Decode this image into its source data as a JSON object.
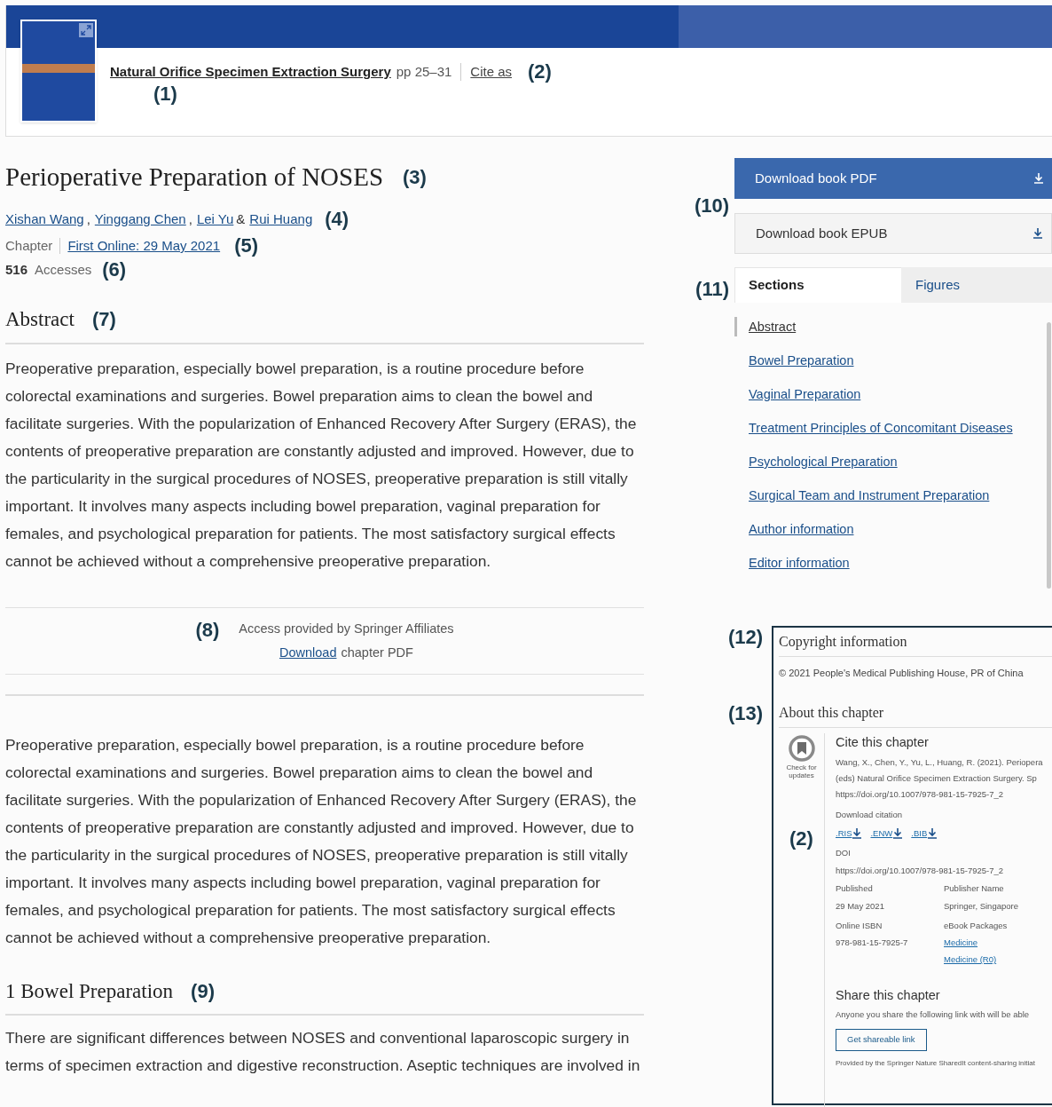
{
  "header": {
    "book_title": "Natural Orifice Specimen Extraction Surgery",
    "pages": "pp 25–31",
    "cite_link": "Cite as",
    "title_marker": "(1)",
    "cite_marker": "(2)"
  },
  "chapter": {
    "title": "Perioperative Preparation of NOSES",
    "title_marker": "(3)",
    "authors": [
      {
        "name": "Xishan Wang",
        "sep": ","
      },
      {
        "name": "Yinggang Chen",
        "sep": ","
      },
      {
        "name": "Lei Yu",
        "sep": "&"
      },
      {
        "name": "Rui Huang"
      }
    ],
    "authors_marker": "(4)",
    "type": "Chapter",
    "first_online": "First Online: 29 May 2021",
    "date_marker": "(5)",
    "accesses_count": "516",
    "accesses_label": "Accesses",
    "accesses_marker": "(6)"
  },
  "abstract": {
    "heading": "Abstract",
    "marker": "(7)",
    "text": "Preoperative preparation, especially bowel preparation, is a routine procedure before colorectal examinations and surgeries. Bowel preparation aims to clean the bowel and facilitate surgeries. With the popularization of Enhanced Recovery After Surgery (ERAS), the contents of preoperative preparation are constantly adjusted and improved. However, due to the particularity in the surgical procedures of NOSES, preoperative preparation is still vitally important. It involves many aspects including bowel preparation, vaginal preparation for females, and psychological preparation for patients. The most satisfactory surgical effects cannot be achieved without a comprehensive preoperative preparation."
  },
  "access_box": {
    "marker": "(8)",
    "provided": "Access provided by Springer Affiliates",
    "download_link": "Download",
    "download_rest": "chapter PDF"
  },
  "body": [
    {
      "kind": "paragraph",
      "text": "Preoperative preparation, especially bowel preparation, is a routine procedure before colorectal examinations and surgeries. Bowel preparation aims to clean the bowel and facilitate surgeries. With the popularization of Enhanced Recovery After Surgery (ERAS), the contents of preoperative preparation are constantly adjusted and improved. However, due to the particularity in the surgical procedures of NOSES, preoperative preparation is still vitally important. It involves many aspects including bowel preparation, vaginal preparation for females, and psychological preparation for patients. The most satisfactory surgical effects cannot be achieved without a comprehensive preoperative preparation."
    },
    {
      "kind": "heading",
      "text": "1 Bowel Preparation",
      "marker": "(9)"
    },
    {
      "kind": "paragraph",
      "text": "There are significant differences between NOSES and conventional laparoscopic surgery in terms of specimen extraction and digestive reconstruction. Aseptic techniques are involved in"
    }
  ],
  "downloads": {
    "marker": "(10)",
    "buttons": [
      {
        "label": "Download book PDF",
        "kind": "primary"
      },
      {
        "label": "Download book EPUB",
        "kind": "secondary"
      }
    ]
  },
  "navigation": {
    "marker": "(11)",
    "tabs": [
      {
        "label": "Sections",
        "selected": true
      },
      {
        "label": "Figures",
        "selected": false
      }
    ],
    "sections": [
      {
        "label": "Abstract",
        "selected": true
      },
      {
        "label": "Bowel Preparation",
        "selected": false
      },
      {
        "label": "Vaginal Preparation",
        "selected": false
      },
      {
        "label": "Treatment Principles of Concomitant Diseases",
        "selected": false
      },
      {
        "label": "Psychological Preparation",
        "selected": false
      },
      {
        "label": "Surgical Team and Instrument Preparation",
        "selected": false
      },
      {
        "label": "Author information",
        "selected": false
      },
      {
        "label": "Editor information",
        "selected": false
      }
    ]
  },
  "copyright": {
    "marker": "(12)",
    "heading": "Copyright information",
    "text": "© 2021 People's Medical Publishing House, PR of China"
  },
  "about": {
    "marker": "(13)",
    "heading": "About this chapter",
    "check_updates": "Check for updates",
    "cite_marker": "(2)",
    "cite_heading": "Cite this chapter",
    "citation_lines": [
      "Wang, X., Chen, Y., Yu, L., Huang, R. (2021). Periopera",
      "(eds) Natural Orifice Specimen Extraction Surgery. Sp",
      "https://doi.org/10.1007/978-981-15-7925-7_2"
    ],
    "download_citation_label": "Download citation",
    "citation_formats": [
      ".RIS",
      ".ENW",
      ".BIB"
    ],
    "doi_label": "DOI",
    "doi": "https://doi.org/10.1007/978-981-15-7925-7_2",
    "fields": [
      {
        "label": "Published",
        "values": [
          "29 May 2021"
        ],
        "kind": "text"
      },
      {
        "label": "Publisher Name",
        "values": [
          "Springer, Singapore"
        ],
        "kind": "text"
      },
      {
        "label": "Online ISBN",
        "values": [
          "978-981-15-7925-7"
        ],
        "kind": "text"
      },
      {
        "label": "eBook Packages",
        "values": [
          "Medicine",
          "Medicine (R0)"
        ],
        "kind": "link"
      }
    ],
    "share_heading": "Share this chapter",
    "share_text": "Anyone you share the following link with will be able",
    "share_button": "Get shareable link",
    "sharedit_note": "Provided by the Springer Nature SharedIt content-sharing initiat"
  }
}
